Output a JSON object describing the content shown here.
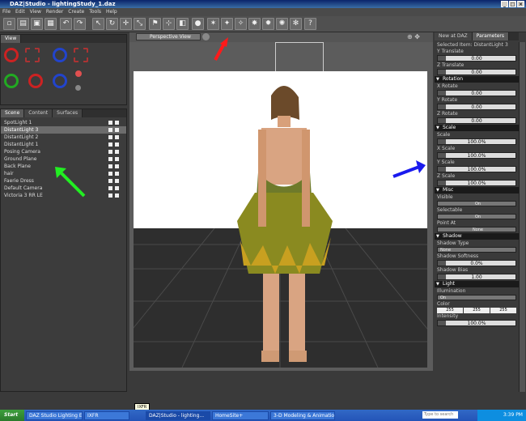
{
  "window": {
    "title": "DAZ|Studio - lightingStudy_1.daz"
  },
  "menu": [
    "File",
    "Edit",
    "View",
    "Render",
    "Create",
    "Tools",
    "Help"
  ],
  "view_panel": {
    "title": "View"
  },
  "scene_panel": {
    "tabs": [
      "Scene",
      "Content",
      "Surfaces"
    ],
    "items": [
      {
        "label": "SpotLight 1",
        "selected": false
      },
      {
        "label": "DistantLight 3",
        "selected": true
      },
      {
        "label": "DistantLight 2",
        "selected": false
      },
      {
        "label": "DistantLight 1",
        "selected": false
      },
      {
        "label": "Posing Camera",
        "selected": false
      },
      {
        "label": "Ground Plane",
        "selected": false
      },
      {
        "label": "Back Plane",
        "selected": false
      },
      {
        "label": "hair",
        "selected": false
      },
      {
        "label": "Faerie Dress",
        "selected": false
      },
      {
        "label": "Default Camera",
        "selected": false
      },
      {
        "label": "Victoria 3 RR LE",
        "selected": false
      }
    ]
  },
  "viewport": {
    "dropdown": "Perspective View"
  },
  "params_panel": {
    "tabs": [
      "New at DAZ",
      "Parameters"
    ],
    "selected_item": "Selected Item:  DistantLight 3",
    "y_translate_label": "Y Translate",
    "y_translate": "0.00",
    "z_translate_label": "Z Translate",
    "z_translate": "0.00",
    "rotation_section": "Rotation",
    "x_rotate_label": "X Rotate",
    "x_rotate": "0.00",
    "y_rotate_label": "Y Rotate",
    "y_rotate": "0.00",
    "z_rotate_label": "Z Rotate",
    "z_rotate": "0.00",
    "scale_section": "Scale",
    "scale_label": "Scale",
    "scale": "100.0%",
    "x_scale_label": "X Scale",
    "x_scale": "100.0%",
    "y_scale_label": "Y Scale",
    "y_scale": "100.0%",
    "z_scale_label": "Z Scale",
    "z_scale": "100.0%",
    "misc_section": "Misc",
    "visible_label": "Visible",
    "visible": "On",
    "selectable_label": "Selectable",
    "selectable": "On",
    "point_at_label": "Point At",
    "point_at": "None",
    "shadow_section": "Shadow",
    "shadow_type_label": "Shadow Type",
    "shadow_type": "None",
    "shadow_softness_label": "Shadow Softness",
    "shadow_softness": "0.0%",
    "shadow_bias_label": "Shadow Bias",
    "shadow_bias": "1.00",
    "light_section": "Light",
    "illumination_label": "Illumination",
    "illumination": "On",
    "color_label": "Color",
    "color_r": "255",
    "color_g": "255",
    "color_b": "255",
    "intensity_label": "Intensity",
    "intensity": "100.0%"
  },
  "taskbar": {
    "start": "Start",
    "tasks": [
      "DAZ Studio Lighting Exer...",
      "IXFR",
      "DAZ|Studio - lighting...",
      "HomeSite+",
      "3-D Modeling & Animatio..."
    ],
    "tooltip": "IXFR",
    "search_placeholder": "Type to search",
    "clock": "3:39 PM"
  },
  "colors": {
    "arrow_red": "#ff1a1a",
    "arrow_green": "#22ee22",
    "arrow_blue": "#1a1aee"
  }
}
